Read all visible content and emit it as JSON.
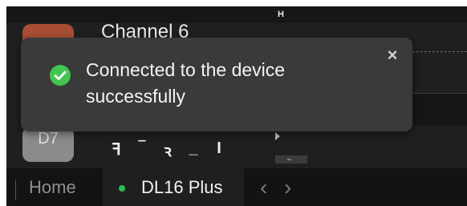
{
  "top_marker": "H",
  "channel": {
    "name": "Channel 6",
    "next_chip_label": "D7"
  },
  "toolbar_symbols": [
    "ꟻ",
    "‾",
    "ꝛ",
    "_",
    "I"
  ],
  "toast": {
    "message": "Connected to the device successfully",
    "status_icon": "check-circle-icon",
    "close_icon": "close-icon",
    "close_glyph": "×",
    "accent_color": "#43c552"
  },
  "tabs": {
    "home_label": "Home",
    "device_label": "DL16 Plus",
    "device_status_color": "#27c04a",
    "prev_glyph": "‹",
    "next_glyph": "›"
  }
}
